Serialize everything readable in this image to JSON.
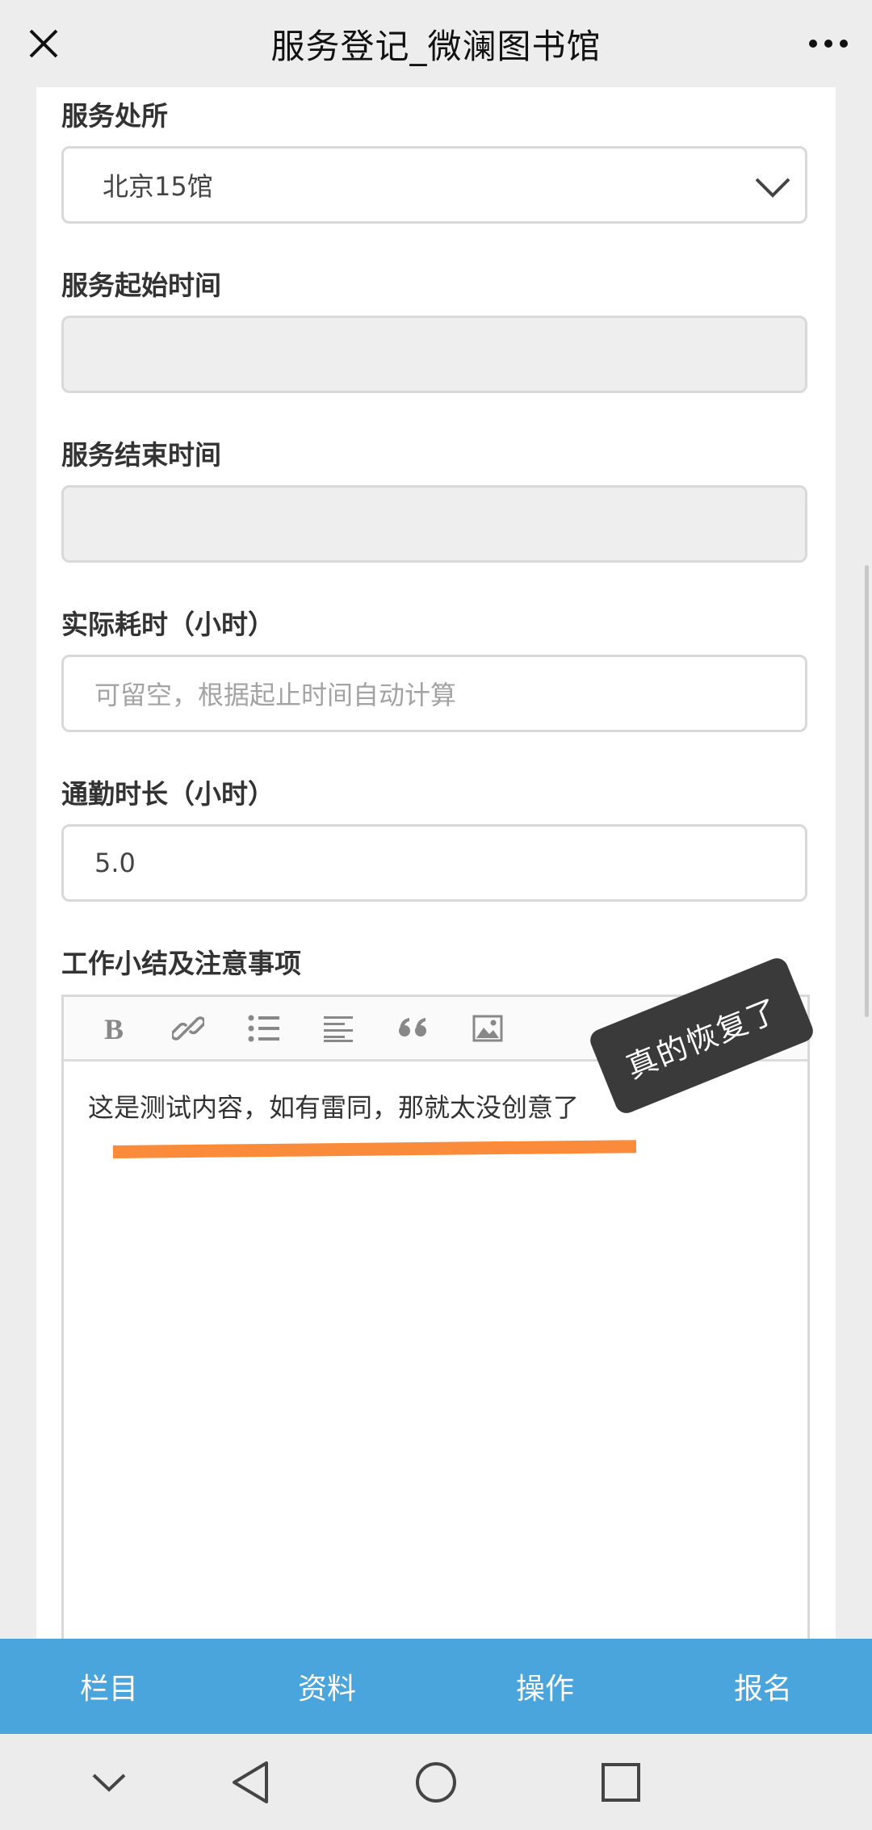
{
  "header": {
    "title": "服务登记_微澜图书馆",
    "close_icon": "close-icon",
    "more_icon": "more-horizontal-icon"
  },
  "form": {
    "location": {
      "label": "服务处所",
      "value": "北京15馆"
    },
    "start_time": {
      "label": "服务起始时间",
      "value": ""
    },
    "end_time": {
      "label": "服务结束时间",
      "value": ""
    },
    "actual_hours": {
      "label": "实际耗时（小时）",
      "placeholder": "可留空，根据起止时间自动计算",
      "value": ""
    },
    "commute_hours": {
      "label": "通勤时长（小时）",
      "value": "5.0"
    },
    "summary": {
      "label": "工作小结及注意事项",
      "content": "这是测试内容，如有雷同，那就太没创意了",
      "toolbar_icons": [
        "bold-icon",
        "link-icon",
        "bulleted-list-icon",
        "align-left-icon",
        "quote-icon",
        "image-icon"
      ]
    }
  },
  "annotation": {
    "tag_text": "真的恢复了",
    "tag_color": "#3a3a3a",
    "underline_color": "#fa8b3a"
  },
  "tabs": [
    "栏目",
    "资料",
    "操作",
    "报名"
  ],
  "colors": {
    "accent": "#4ba5dd"
  },
  "system_nav": [
    "chevron-down-icon",
    "back-icon",
    "home-icon",
    "recents-icon"
  ]
}
